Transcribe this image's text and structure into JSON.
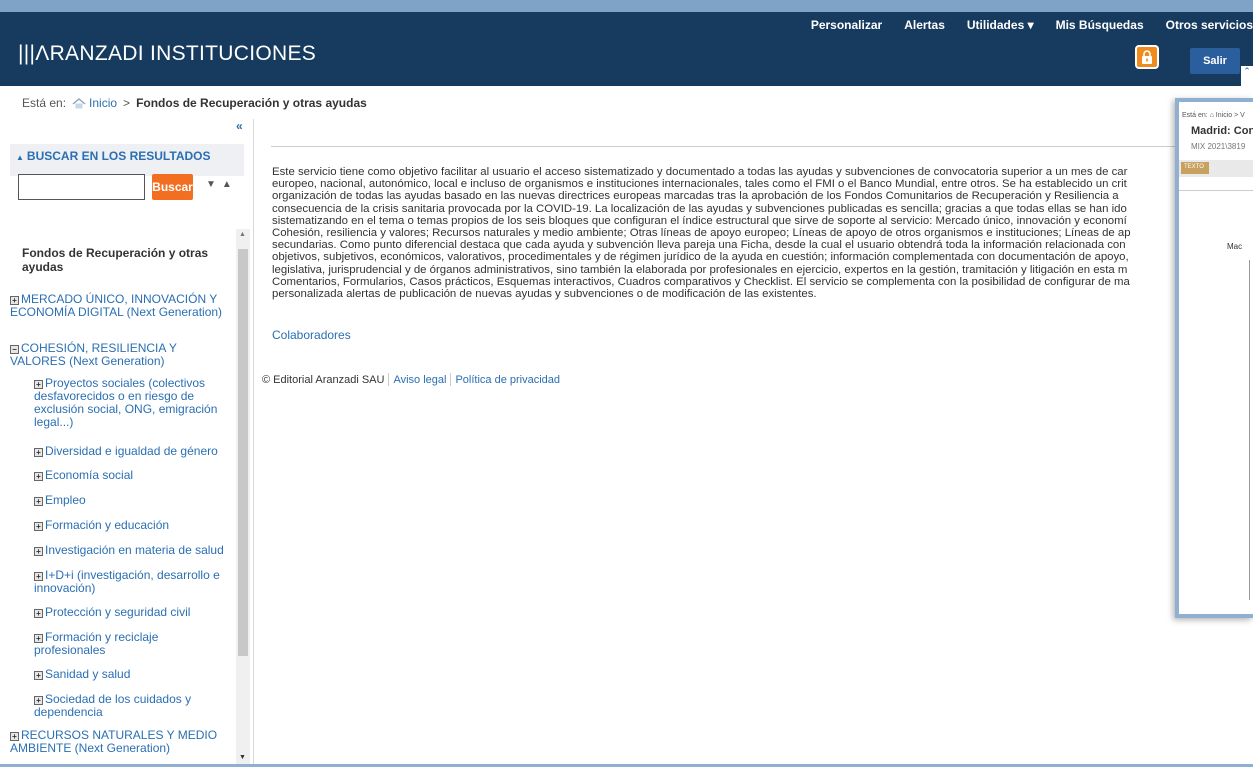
{
  "header": {
    "logo": "|||ΛRANZADI INSTITUCIONES",
    "nav": [
      {
        "label": "Personalizar"
      },
      {
        "label": "Alertas"
      },
      {
        "label": "Utilidades ▾"
      },
      {
        "label": "Mis Búsquedas"
      },
      {
        "label": "Otros servicios"
      }
    ],
    "salir_label": "Salir",
    "collapse_icon": "chevron-up-icon"
  },
  "breadcrumb": {
    "prefix": "Está en:",
    "home": "Inicio",
    "separator": ">",
    "current": "Fondos de Recuperación y otras ayudas"
  },
  "sidebar": {
    "collapse": "«",
    "search_heading": "BUSCAR EN LOS RESULTADOS",
    "search_value": "",
    "search_button": "Buscar",
    "sort_arrows": "▼▲",
    "tree_title": "Fondos de Recuperación y otras ayudas",
    "tree": [
      {
        "label": "MERCADO ÚNICO, INNOVACIÓN Y ECONOMÍA DIGITAL (Next Generation)",
        "state": "+"
      },
      {
        "label": "COHESIÓN, RESILIENCIA Y VALORES (Next Generation)",
        "state": "−"
      },
      {
        "label": "Proyectos sociales (colectivos desfavorecidos o en riesgo de exclusión social, ONG, emigración legal...)",
        "state": "+"
      },
      {
        "label": "Diversidad e igualdad de género",
        "state": "+"
      },
      {
        "label": "Economía social",
        "state": "+"
      },
      {
        "label": "Empleo",
        "state": "+"
      },
      {
        "label": "Formación y educación",
        "state": "+"
      },
      {
        "label": "Investigación en materia de salud",
        "state": "+"
      },
      {
        "label": "I+D+i (investigación, desarrollo e innovación)",
        "state": "+"
      },
      {
        "label": "Protección y seguridad civil",
        "state": "+"
      },
      {
        "label": "Formación y reciclaje profesionales",
        "state": "+"
      },
      {
        "label": "Sanidad y salud",
        "state": "+"
      },
      {
        "label": "Sociedad de los cuidados y dependencia",
        "state": "+"
      },
      {
        "label": "RECURSOS NATURALES Y MEDIO AMBIENTE (Next Generation)",
        "state": "+"
      }
    ]
  },
  "main": {
    "description": "Este servicio tiene como objetivo facilitar al usuario el acceso sistematizado y documentado a todas las ayudas y subvenciones de convocatoria superior a un mes de car\neuropeo, nacional, autonómico, local e incluso de organismos e instituciones internacionales, tales como el FMI o el Banco Mundial, entre otros. Se ha establecido un crit\norganización de todas las ayudas basado en las nuevas directrices europeas marcadas tras la aprobación de los Fondos Comunitarios de Recuperación y Resiliencia a\nconsecuencia de la crisis sanitaria provocada por la COVID-19. La localización de las ayudas y subvenciones publicadas es sencilla; gracias a que todas ellas se han ido\nsistematizando en el tema o temas propios de los seis bloques que configuran el índice estructural que sirve de soporte al servicio: Mercado único, innovación y economí\nCohesión, resiliencia y valores; Recursos naturales y medio ambiente; Otras líneas de apoyo europeo; Líneas de apoyo de otros organismos e instituciones; Líneas de ap\nsecundarias. Como punto diferencial destaca que cada ayuda y subvención lleva pareja una Ficha, desde la cual el usuario obtendrá toda la información relacionada con\nobjetivos, subjetivos, económicos, valorativos, procedimentales y de régimen jurídico de la ayuda en cuestión; información complementada con documentación de apoyo,\nlegislativa, jurisprudencial y de órganos administrativos, sino también la elaborada por profesionales en ejercicio, expertos en la gestión, tramitación y litigación en esta m\nComentarios, Formularios, Casos prácticos, Esquemas interactivos, Cuadros comparativos y Checklist. El servicio se complementa con la posibilidad de configurar de ma\npersonalizada alertas de publicación de nuevas ayudas y subvenciones o de modificación de las existentes.",
    "colaboradores": "Colaboradores"
  },
  "footer": {
    "copyright": "© Editorial Aranzadi SAU",
    "aviso": "Aviso legal",
    "privacidad": "Política de privacidad"
  },
  "preview": {
    "breadcrumb": "Está en: ⌂ Inicio > V",
    "title": "Madrid: Con",
    "ref": "MIX 2021\\3819",
    "tab": "TEXTO",
    "body": "Mac"
  },
  "colors": {
    "header_bg": "#173b5f",
    "link": "#2a6fb3",
    "button_orange": "#f26f21"
  }
}
